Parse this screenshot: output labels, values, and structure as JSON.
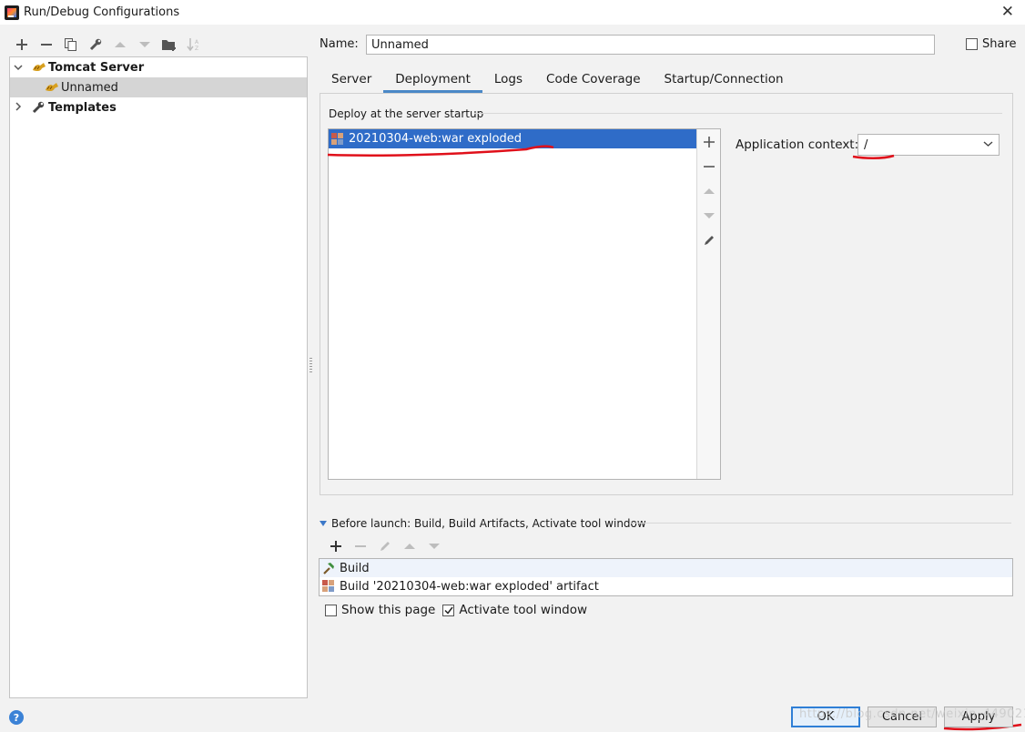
{
  "window": {
    "title": "Run/Debug Configurations"
  },
  "left_toolbar": {
    "icons": [
      "add-icon",
      "remove-icon",
      "copy-icon",
      "wrench-icon",
      "move-up-icon",
      "move-down-icon",
      "new-folder-icon",
      "sort-icon"
    ]
  },
  "tree": {
    "items": [
      {
        "label": "Tomcat Server",
        "expanded": true,
        "level": 0
      },
      {
        "label": "Unnamed",
        "selected": true,
        "level": 1
      },
      {
        "label": "Templates",
        "expanded": false,
        "level": 0
      }
    ]
  },
  "name_field": {
    "label": "Name:",
    "value": "Unnamed"
  },
  "share": {
    "label": "Share",
    "checked": false
  },
  "tabs": [
    {
      "label": "Server",
      "active": false
    },
    {
      "label": "Deployment",
      "active": true
    },
    {
      "label": "Logs",
      "active": false
    },
    {
      "label": "Code Coverage",
      "active": false
    },
    {
      "label": "Startup/Connection",
      "active": false
    }
  ],
  "deployment": {
    "group_label": "Deploy at the server startup",
    "artifacts": [
      {
        "label": "20210304-web:war exploded",
        "selected": true
      }
    ],
    "app_context_label": "Application context:",
    "app_context_value": "/"
  },
  "before_launch": {
    "header": "Before launch: Build, Build Artifacts, Activate tool window",
    "items": [
      {
        "label": "Build"
      },
      {
        "label": "Build '20210304-web:war exploded' artifact"
      }
    ]
  },
  "options": {
    "show_page": {
      "label": "Show this page",
      "checked": false
    },
    "activate_tool": {
      "label": "Activate tool window",
      "checked": true
    }
  },
  "buttons": {
    "ok": "OK",
    "cancel": "Cancel",
    "apply": "Apply"
  },
  "watermark": "https://blog.csdn.net/weixin_44902124",
  "colors": {
    "selection": "#2f6cc8",
    "tab_underline": "#4a88c7",
    "annotation": "#e0101a"
  }
}
